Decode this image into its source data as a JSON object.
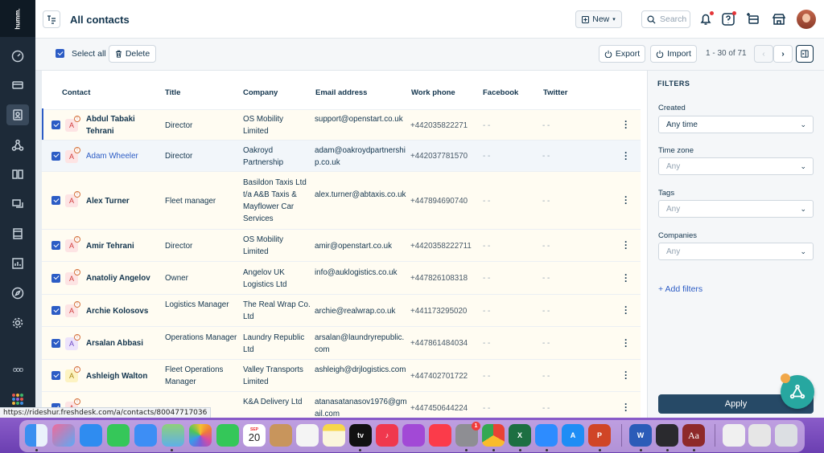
{
  "app": {
    "logo_text": "humm.",
    "page_title": "All contacts"
  },
  "sidebar": {
    "items": [
      {
        "icon": "dashboard-icon",
        "active": false
      },
      {
        "icon": "ticket-icon",
        "active": false
      },
      {
        "icon": "contacts-icon",
        "active": true
      },
      {
        "icon": "companies-icon",
        "active": false
      },
      {
        "icon": "knowledge-base-icon",
        "active": false
      },
      {
        "icon": "conversations-icon",
        "active": false
      },
      {
        "icon": "phone-icon",
        "active": false
      },
      {
        "icon": "reports-icon",
        "active": false
      },
      {
        "icon": "compass-icon",
        "active": false
      },
      {
        "icon": "settings-icon",
        "active": false
      },
      {
        "icon": "more-icon",
        "active": false
      }
    ],
    "more_label": "ooo"
  },
  "header": {
    "new_label": "New",
    "search_placeholder": "Search"
  },
  "toolbar": {
    "select_all_label": "Select all",
    "delete_label": "Delete",
    "export_label": "Export",
    "import_label": "Import",
    "pagination": "1 - 30 of 71"
  },
  "table": {
    "columns": [
      "Contact",
      "Title",
      "Company",
      "Email address",
      "Work phone",
      "Facebook",
      "Twitter"
    ],
    "rows": [
      {
        "name": "Abdul Tabaki Tehrani",
        "title": "Director",
        "company": "OS Mobility Limited",
        "email": "support@openstart.co.uk",
        "phone": "+442035822271",
        "facebook": "- -",
        "twitter": "- -",
        "avatar": "A",
        "avatar_color": "red"
      },
      {
        "name": "Adam Wheeler",
        "title": "Director",
        "company": "Oakroyd Partnership",
        "email": "adam@oakroydpartnership.co.uk",
        "phone": "+442037781570",
        "facebook": "- -",
        "twitter": "- -",
        "avatar": "A",
        "avatar_color": "red"
      },
      {
        "name": "Alex Turner",
        "title": "Fleet manager",
        "company": "Basildon Taxis Ltd t/a A&B Taxis & Mayflower Car Services",
        "email": "alex.turner@abtaxis.co.uk",
        "phone": "+447894690740",
        "facebook": "- -",
        "twitter": "- -",
        "avatar": "A",
        "avatar_color": "red"
      },
      {
        "name": "Amir Tehrani",
        "title": "Director",
        "company": "OS Mobility Limited",
        "email": "amir@openstart.co.uk",
        "phone": "+4420358222711",
        "facebook": "- -",
        "twitter": "- -",
        "avatar": "A",
        "avatar_color": "red"
      },
      {
        "name": "Anatoliy Angelov",
        "title": "Owner",
        "company": "Angelov UK Logistics Ltd",
        "email": "info@auklogistics.co.uk",
        "phone": "+447826108318",
        "facebook": "- -",
        "twitter": "- -",
        "avatar": "A",
        "avatar_color": "red"
      },
      {
        "name": "Archie Kolosovs",
        "title": "Logistics Manager",
        "company": "The Real Wrap Co. Ltd",
        "email": "archie@realwrap.co.uk",
        "phone": "+441173295020",
        "facebook": "- -",
        "twitter": "- -",
        "avatar": "A",
        "avatar_color": "red"
      },
      {
        "name": "Arsalan Abbasi",
        "title": "Operations Manager",
        "company": "Laundry Republic Ltd",
        "email": "arsalan@laundryrepublic.com",
        "phone": "+447861484034",
        "facebook": "- -",
        "twitter": "- -",
        "avatar": "A",
        "avatar_color": "purple"
      },
      {
        "name": "Ashleigh Walton",
        "title": "Fleet Operations Manager",
        "company": "Valley Transports Limited",
        "email": "ashleigh@drjlogistics.com",
        "phone": "+447402701722",
        "facebook": "- -",
        "twitter": "- -",
        "avatar": "A",
        "avatar_color": "yellow"
      },
      {
        "name": "",
        "title": "",
        "company": "K&A Delivery Ltd",
        "email": "atanasatanasov1976@gmail.com",
        "phone": "+447450644224",
        "facebook": "- -",
        "twitter": "- -",
        "avatar": "A",
        "avatar_color": "red"
      }
    ]
  },
  "filters": {
    "heading": "FILTERS",
    "created_label": "Created",
    "created_value": "Any time",
    "timezone_label": "Time zone",
    "timezone_value": "Any",
    "tags_label": "Tags",
    "tags_value": "Any",
    "companies_label": "Companies",
    "companies_value": "Any",
    "add_filters": "+ Add filters",
    "apply_label": "Apply"
  },
  "statusbar": {
    "url": "https://rideshur.freshdesk.com/a/contacts/80047717036"
  },
  "dock": {
    "calendar_month": "SEP",
    "calendar_day": "20",
    "tv_label": "tv",
    "dictionary_label": "Aa",
    "settings_badge": "1"
  },
  "colors": {
    "primary": "#2c5cc5",
    "sidebar": "#1d2a38",
    "apply": "#264966",
    "fab": "#27a7a0"
  }
}
